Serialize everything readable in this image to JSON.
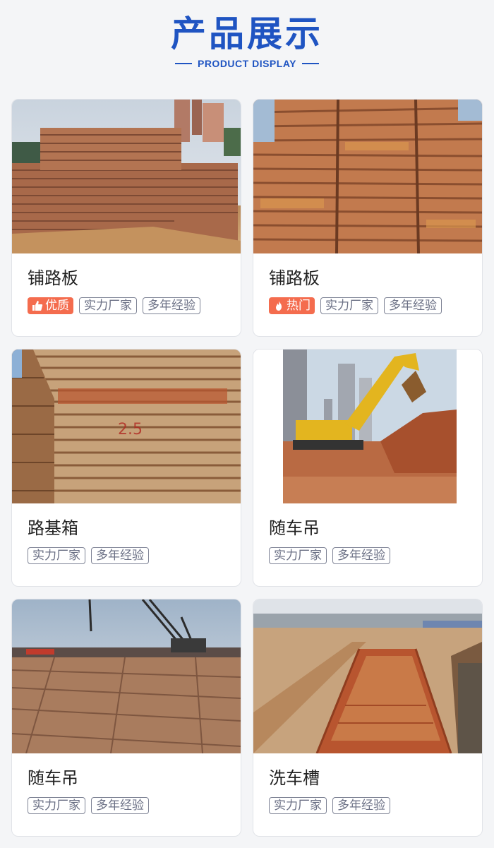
{
  "header": {
    "title": "产品展示",
    "subtitle": "PRODUCT DISPLAY"
  },
  "products": [
    {
      "name": "铺路板",
      "badge": {
        "label": "优质",
        "icon": "thumbs-up-icon"
      },
      "tags": [
        "实力厂家",
        "多年经验"
      ],
      "image": "road-plates-stacked"
    },
    {
      "name": "铺路板",
      "badge": {
        "label": "热门",
        "icon": "flame-icon"
      },
      "tags": [
        "实力厂家",
        "多年经验"
      ],
      "image": "road-plates-pile"
    },
    {
      "name": "路基箱",
      "tags": [
        "实力厂家",
        "多年经验"
      ],
      "image": "roadbed-box-stack"
    },
    {
      "name": "随车吊",
      "tags": [
        "实力厂家",
        "多年经验"
      ],
      "image": "excavator-on-site"
    },
    {
      "name": "随车吊",
      "tags": [
        "实力厂家",
        "多年经验"
      ],
      "image": "crane-on-plates"
    },
    {
      "name": "洗车槽",
      "tags": [
        "实力厂家",
        "多年经验"
      ],
      "image": "car-wash-trough"
    }
  ],
  "colors": {
    "brand": "#1f54c2",
    "badge": "#f46c4e",
    "tag_border": "#7e8395"
  }
}
